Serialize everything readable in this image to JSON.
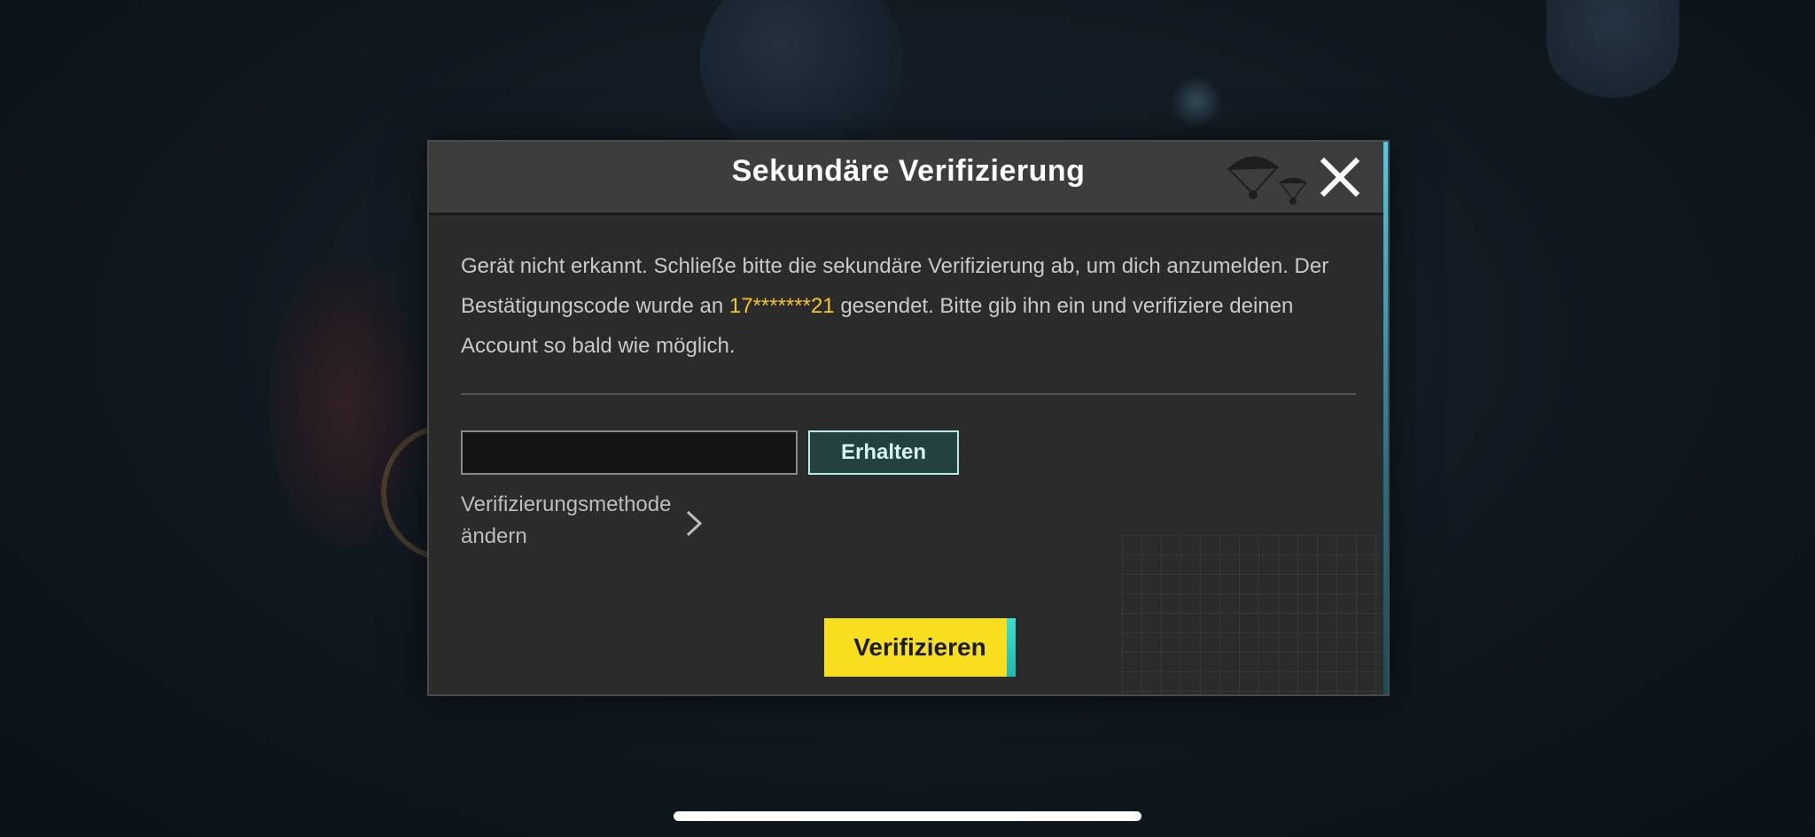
{
  "dialog": {
    "title": "Sekundäre Verifizierung",
    "message_part1": "Gerät nicht erkannt. Schließe bitte die sekundäre Verifizierung ab, um dich anzumelden. Der Bestätigungscode wurde an ",
    "masked_phone": "17*******21",
    "message_part2": " gesendet. Bitte gib ihn ein und verifiziere deinen Account so bald wie möglich.",
    "code_input": {
      "value": "",
      "placeholder": ""
    },
    "get_code_label": "Erhalten",
    "change_method_label": "Verifizierungsmethode ändern",
    "verify_label": "Verifizieren",
    "close_icon": "close-icon",
    "chevron_icon": "chevron-right-icon"
  },
  "colors": {
    "accent_yellow": "#f7de1f",
    "highlight_text": "#f5c623",
    "teal_border": "#b8ece8",
    "dialog_bg": "#2b2b2b"
  }
}
